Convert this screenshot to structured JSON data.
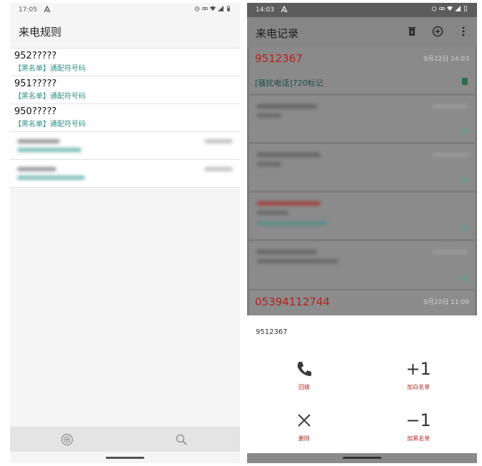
{
  "left": {
    "status": {
      "time": "17:05",
      "notif_glyph": "⚡"
    },
    "title": "来电规则",
    "rules": [
      {
        "number": "952?????",
        "type": "【黑名单】通配符号码"
      },
      {
        "number": "951?????",
        "type": "【黑名单】通配符号码"
      },
      {
        "number": "950?????",
        "type": "【黑名单】通配符号码"
      }
    ],
    "bottom_icons": [
      "add-circle-icon",
      "search-icon"
    ]
  },
  "right": {
    "status": {
      "time": "14:03"
    },
    "title": "来电记录",
    "actions": [
      "delete-icon",
      "add-icon",
      "more-vert-icon"
    ],
    "first_call": {
      "number": "9512367",
      "date": "9月22日 14:03",
      "tag": "[骚扰电话]720标记"
    },
    "last_call": {
      "number": "05394112744",
      "date": "9月20日 11:09"
    },
    "sheet": {
      "number": "9512367",
      "call_back": "回拨",
      "add_white": "加白名单",
      "delete": "删除",
      "add_black": "加黑名单",
      "plus_one": "+1",
      "minus_one": "−1"
    }
  },
  "colors": {
    "accent_red": "#b5231e",
    "teal": "#2f8f84"
  }
}
